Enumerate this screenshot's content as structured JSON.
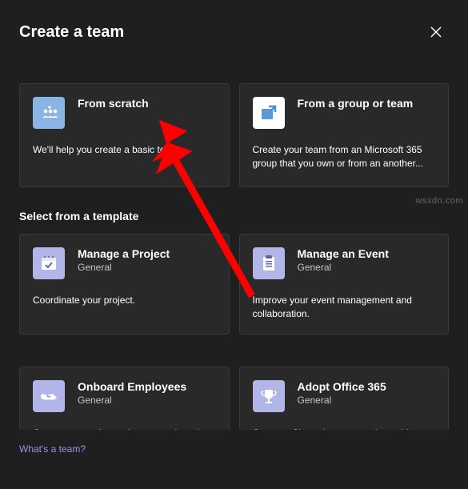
{
  "header": {
    "title": "Create a team"
  },
  "mainOptions": {
    "fromScratch": {
      "title": "From scratch",
      "desc": "We'll help you create a basic team."
    },
    "fromGroup": {
      "title": "From a group or team",
      "desc": "Create your team from an Microsoft 365 group that you own or from an another..."
    }
  },
  "templatesSection": {
    "title": "Select from a template"
  },
  "templates": {
    "project": {
      "title": "Manage a Project",
      "subtitle": "General",
      "desc": "Coordinate your project."
    },
    "event": {
      "title": "Manage an Event",
      "subtitle": "General",
      "desc": "Improve your event management and collaboration."
    },
    "onboard": {
      "title": "Onboard Employees",
      "subtitle": "General",
      "desc": "Create a central experience to onboard"
    },
    "adopt": {
      "title": "Adopt Office 365",
      "subtitle": "General",
      "desc": "Create a Champion community to drive"
    }
  },
  "footer": {
    "link": "What's a team?"
  },
  "watermark": "wsxdn.com"
}
